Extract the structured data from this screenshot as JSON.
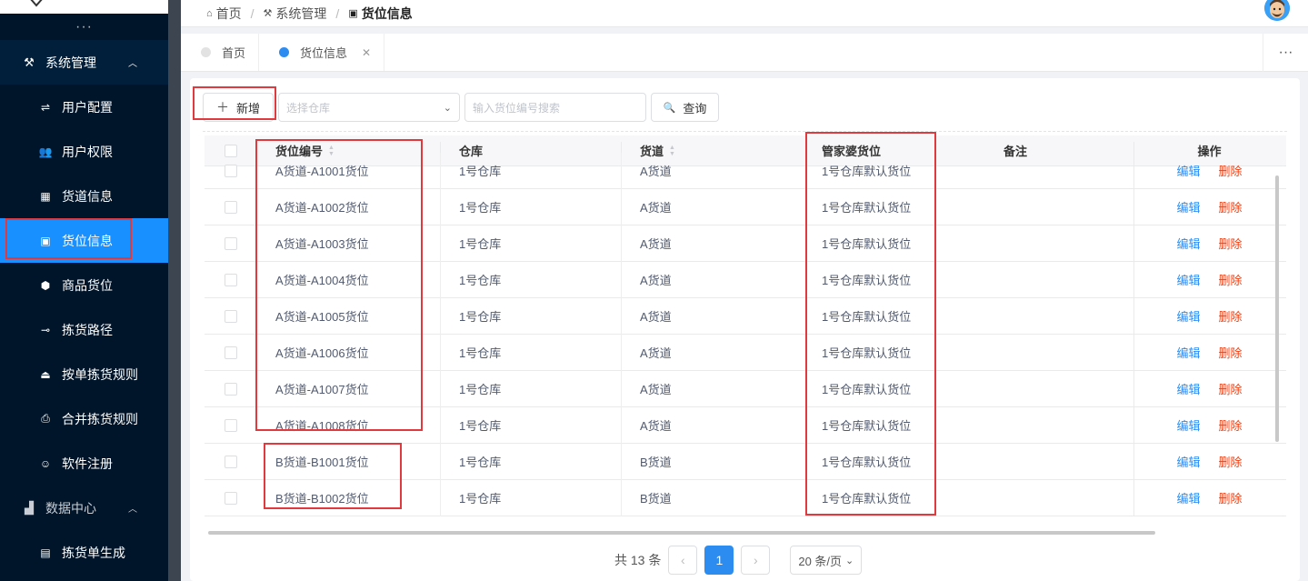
{
  "sidebar": {
    "more": "···",
    "groups": [
      {
        "label": "系统管理",
        "icon": "tools-icon",
        "expanded": true
      },
      {
        "label": "数据中心",
        "icon": "bar-chart-icon",
        "expanded": true
      }
    ],
    "items": [
      {
        "label": "用户配置",
        "icon": "sliders-icon",
        "glyph": "⇌"
      },
      {
        "label": "用户权限",
        "icon": "users-icon",
        "glyph": "👥"
      },
      {
        "label": "货道信息",
        "icon": "grid-icon",
        "glyph": "▦"
      },
      {
        "label": "货位信息",
        "icon": "box-icon",
        "glyph": "▣",
        "active": true
      },
      {
        "label": "商品货位",
        "icon": "cube-icon",
        "glyph": "⬢"
      },
      {
        "label": "拣货路径",
        "icon": "route-icon",
        "glyph": "⊸"
      },
      {
        "label": "按单拣货规则",
        "icon": "tray-icon",
        "glyph": "⏏"
      },
      {
        "label": "合并拣货规则",
        "icon": "printer-icon",
        "glyph": "⎙"
      },
      {
        "label": "软件注册",
        "icon": "smile-icon",
        "glyph": "☺"
      }
    ],
    "data_items": [
      {
        "label": "拣货单生成",
        "icon": "list-icon",
        "glyph": "▤"
      }
    ]
  },
  "breadcrumb": [
    "首页",
    "系统管理",
    "货位信息"
  ],
  "tabs": [
    {
      "label": "首页",
      "active": false
    },
    {
      "label": "货位信息",
      "active": true,
      "closable": true
    }
  ],
  "tab_more": "···",
  "toolbar": {
    "add_label": "新增",
    "warehouse_placeholder": "选择仓库",
    "search_placeholder": "输入货位编号搜索",
    "search_label": "查询"
  },
  "table": {
    "headers": {
      "code": "货位编号",
      "warehouse": "仓库",
      "lane": "货道",
      "default_slot": "管家婆货位",
      "note": "备注",
      "ops": "操作"
    },
    "rows": [
      {
        "code": "A货道-A1001货位",
        "warehouse": "1号仓库",
        "lane": "A货道",
        "default_slot": "1号仓库默认货位",
        "note": ""
      },
      {
        "code": "A货道-A1002货位",
        "warehouse": "1号仓库",
        "lane": "A货道",
        "default_slot": "1号仓库默认货位",
        "note": ""
      },
      {
        "code": "A货道-A1003货位",
        "warehouse": "1号仓库",
        "lane": "A货道",
        "default_slot": "1号仓库默认货位",
        "note": ""
      },
      {
        "code": "A货道-A1004货位",
        "warehouse": "1号仓库",
        "lane": "A货道",
        "default_slot": "1号仓库默认货位",
        "note": ""
      },
      {
        "code": "A货道-A1005货位",
        "warehouse": "1号仓库",
        "lane": "A货道",
        "default_slot": "1号仓库默认货位",
        "note": ""
      },
      {
        "code": "A货道-A1006货位",
        "warehouse": "1号仓库",
        "lane": "A货道",
        "default_slot": "1号仓库默认货位",
        "note": ""
      },
      {
        "code": "A货道-A1007货位",
        "warehouse": "1号仓库",
        "lane": "A货道",
        "default_slot": "1号仓库默认货位",
        "note": ""
      },
      {
        "code": "A货道-A1008货位",
        "warehouse": "1号仓库",
        "lane": "A货道",
        "default_slot": "1号仓库默认货位",
        "note": ""
      },
      {
        "code": "B货道-B1001货位",
        "warehouse": "1号仓库",
        "lane": "B货道",
        "default_slot": "1号仓库默认货位",
        "note": ""
      },
      {
        "code": "B货道-B1002货位",
        "warehouse": "1号仓库",
        "lane": "B货道",
        "default_slot": "1号仓库默认货位",
        "note": ""
      }
    ],
    "edit_label": "编辑",
    "delete_label": "删除"
  },
  "pagination": {
    "total_text": "共 13 条",
    "current_page": "1",
    "page_size": "20 条/页"
  },
  "colors": {
    "sidebar_bg": "#001529",
    "active": "#1890ff",
    "highlight": "#e0393e",
    "edit": "#2d8cf0",
    "delete": "#ed4014"
  }
}
